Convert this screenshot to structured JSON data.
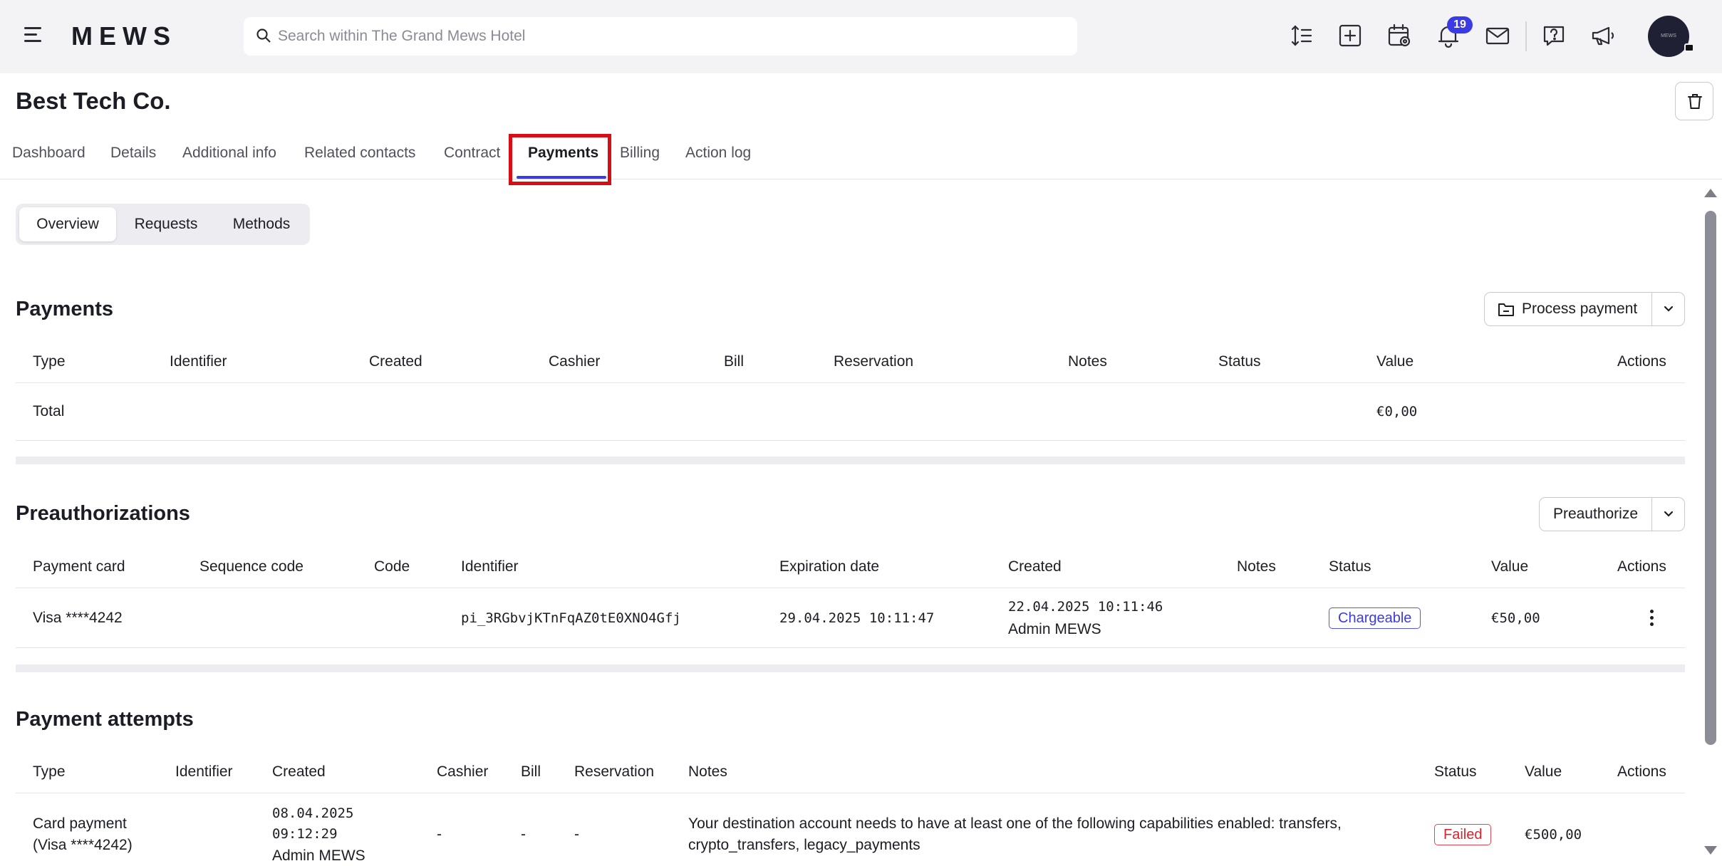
{
  "topbar": {
    "logo": "MEWS",
    "search_placeholder": "Search within The Grand Mews Hotel",
    "notifications_count": "19",
    "avatar_text": "MEWS"
  },
  "header": {
    "title": "Best Tech Co."
  },
  "tabs": [
    {
      "label": "Dashboard"
    },
    {
      "label": "Details"
    },
    {
      "label": "Additional info"
    },
    {
      "label": "Related contacts"
    },
    {
      "label": "Contract"
    },
    {
      "label": "Payments",
      "active": true
    },
    {
      "label": "Billing"
    },
    {
      "label": "Action log"
    }
  ],
  "subtabs": [
    {
      "label": "Overview",
      "active": true
    },
    {
      "label": "Requests"
    },
    {
      "label": "Methods"
    }
  ],
  "payments": {
    "title": "Payments",
    "action_label": "Process payment",
    "columns": [
      "Type",
      "Identifier",
      "Created",
      "Cashier",
      "Bill",
      "Reservation",
      "Notes",
      "Status",
      "Value",
      "Actions"
    ],
    "total_label": "Total",
    "total_value": "€0,00"
  },
  "preauthorizations": {
    "title": "Preauthorizations",
    "action_label": "Preauthorize",
    "columns": [
      "Payment card",
      "Sequence code",
      "Code",
      "Identifier",
      "Expiration date",
      "Created",
      "Notes",
      "Status",
      "Value",
      "Actions"
    ],
    "rows": [
      {
        "payment_card": "Visa ****4242",
        "identifier": "pi_3RGbvjKTnFqAZ0tE0XNO4Gfj",
        "expiration_date": "29.04.2025 10:11:47",
        "created_date": "22.04.2025 10:11:46",
        "created_by": "Admin MEWS",
        "status": "Chargeable",
        "value": "€50,00"
      }
    ]
  },
  "payment_attempts": {
    "title": "Payment attempts",
    "columns": [
      "Type",
      "Identifier",
      "Created",
      "Cashier",
      "Bill",
      "Reservation",
      "Notes",
      "Status",
      "Value",
      "Actions"
    ],
    "rows": [
      {
        "type_line1": "Card payment",
        "type_line2": "(Visa ****4242)",
        "created_date": "08.04.2025",
        "created_time": "09:12:29",
        "created_by": "Admin MEWS",
        "cashier": "-",
        "bill": "-",
        "reservation": "-",
        "notes_line1": "Your destination account needs to have at least one of the following capabilities enabled: transfers,",
        "notes_line2": "crypto_transfers, legacy_payments",
        "status": "Failed",
        "value": "€500,00"
      }
    ]
  },
  "colors": {
    "accent": "#3b3be6",
    "highlight_box": "#d90d16",
    "failed": "#d9232d",
    "topbar_bg": "#f3f3f5"
  }
}
